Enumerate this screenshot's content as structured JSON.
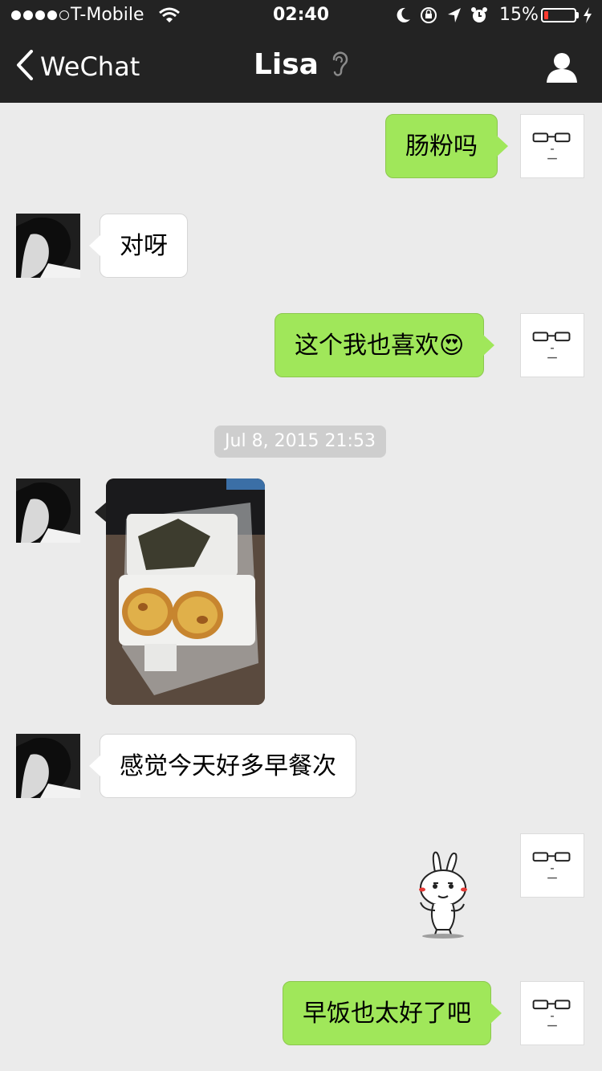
{
  "status_bar": {
    "carrier": "T-Mobile",
    "time": "02:40",
    "battery_percent": "15%",
    "battery_level": 0.15
  },
  "nav": {
    "back_label": "WeChat",
    "title": "Lisa"
  },
  "messages": [
    {
      "sender": "me",
      "text": "肠粉吗"
    },
    {
      "sender": "Lisa",
      "text": "对呀"
    },
    {
      "sender": "me",
      "text": "这个我也喜欢",
      "emoji": "😍"
    },
    {
      "sender": "Lisa",
      "text": "感觉今天好多早餐次"
    },
    {
      "sender": "me",
      "text": "早饭也太好了吧"
    }
  ],
  "timestamp": "Jul 8, 2015 21:53",
  "colors": {
    "header": "#232323",
    "chat_background": "#ebebeb",
    "outgoing_bubble": "#a0e75a",
    "incoming_bubble": "#ffffff"
  },
  "icons": {
    "back": "chevron-left-icon",
    "voice_mode": "ear-icon",
    "contact": "person-icon"
  }
}
